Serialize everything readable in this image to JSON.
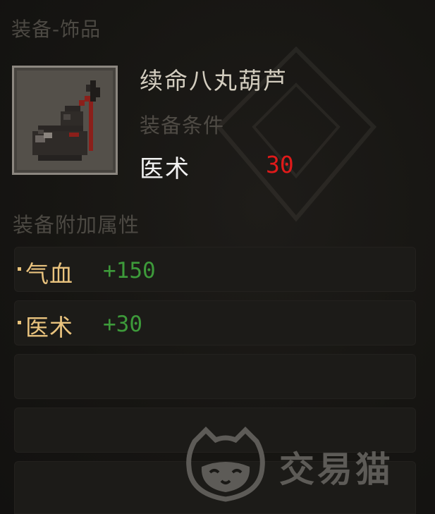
{
  "tooltip": {
    "category_title": "装备-饰品",
    "item": {
      "name": "续命八丸葫芦",
      "icon": "gourd-icon"
    },
    "requirements": {
      "header": "装备条件",
      "skill_label": "医术",
      "skill_value": "30"
    },
    "bonus": {
      "header": "装备附加属性",
      "rows": [
        {
          "label": "气血",
          "value": "+150"
        },
        {
          "label": "医术",
          "value": "+30"
        },
        {
          "label": "",
          "value": ""
        },
        {
          "label": "",
          "value": ""
        },
        {
          "label": "",
          "value": ""
        }
      ]
    }
  },
  "watermark": {
    "text": "交易猫",
    "icon": "cat-logo-icon"
  },
  "colors": {
    "background": "#161512",
    "requirement_value": "#e01a1a",
    "bonus_label": "#e9c37e",
    "bonus_value": "#3d9a3a"
  }
}
